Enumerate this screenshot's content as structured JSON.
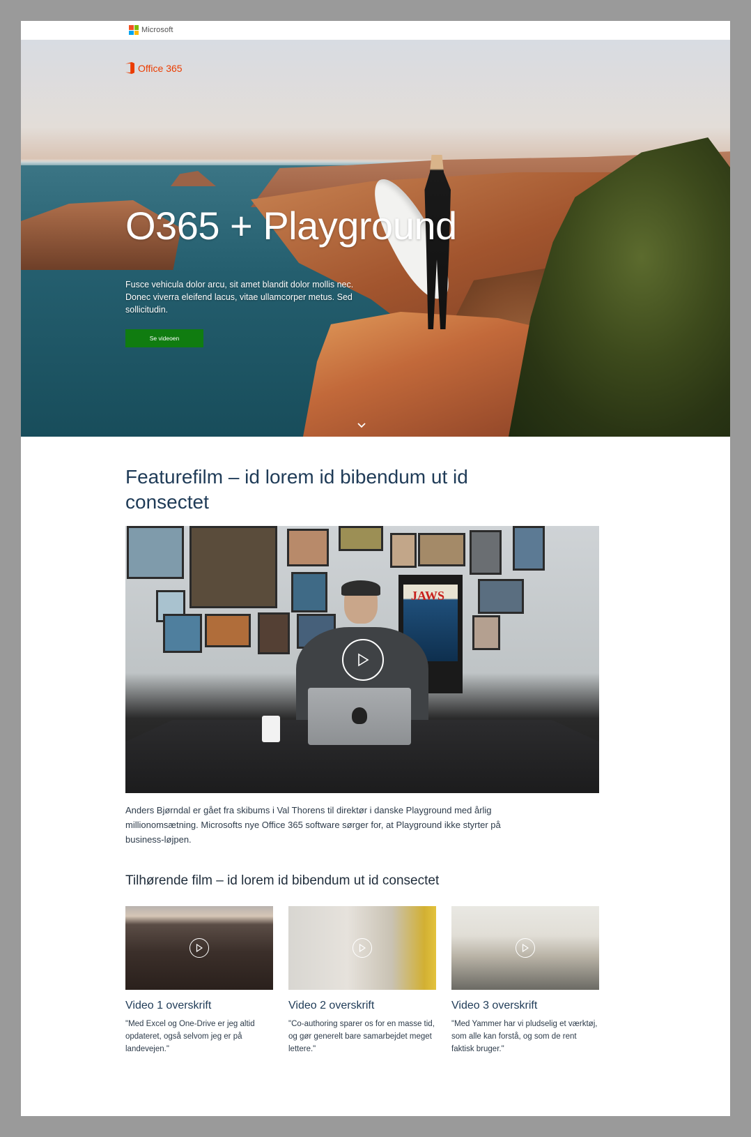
{
  "topbar": {
    "brand_label": "Microsoft",
    "logo_colors": [
      "#f25022",
      "#7fba00",
      "#00a4ef",
      "#ffb900"
    ]
  },
  "hero": {
    "product_label": "Office 365",
    "product_color": "#eb3c00",
    "title": "O365 + Playground",
    "subtitle": "Fusce vehicula dolor arcu, sit amet blandit dolor mollis nec. Donec viverra eleifend lacus, vitae ullamcorper metus. Sed sollicitudin.",
    "cta_label": "Se videoen",
    "cta_color": "#107c10",
    "scroll_icon": "chevron-down-icon"
  },
  "feature": {
    "title": "Featurefilm – id lorem id bibendum ut id consectet",
    "poster_text": "JAWS",
    "play_icon": "play-icon",
    "description": "Anders Bjørndal er gået fra skibums i Val Thorens til direktør i danske Playground med årlig millionomsætning. Microsofts nye Office 365 software sørger for, at Playground ikke styrter på business-løjpen."
  },
  "related": {
    "title": "Tilhørende film – id lorem id bibendum ut id consectet",
    "videos": [
      {
        "title": "Video 1 overskrift",
        "quote": "\"Med Excel og One-Drive er jeg altid opdateret, også selvom jeg er på landevejen.\""
      },
      {
        "title": "Video 2 overskrift",
        "quote": "\"Co-authoring sparer os for en masse tid, og gør generelt bare samarbejdet meget lettere.\""
      },
      {
        "title": "Video 3 overskrift",
        "quote": "\"Med Yammer har vi pludselig et værktøj, som alle kan forstå, og som de rent faktisk bruger.\""
      }
    ]
  }
}
